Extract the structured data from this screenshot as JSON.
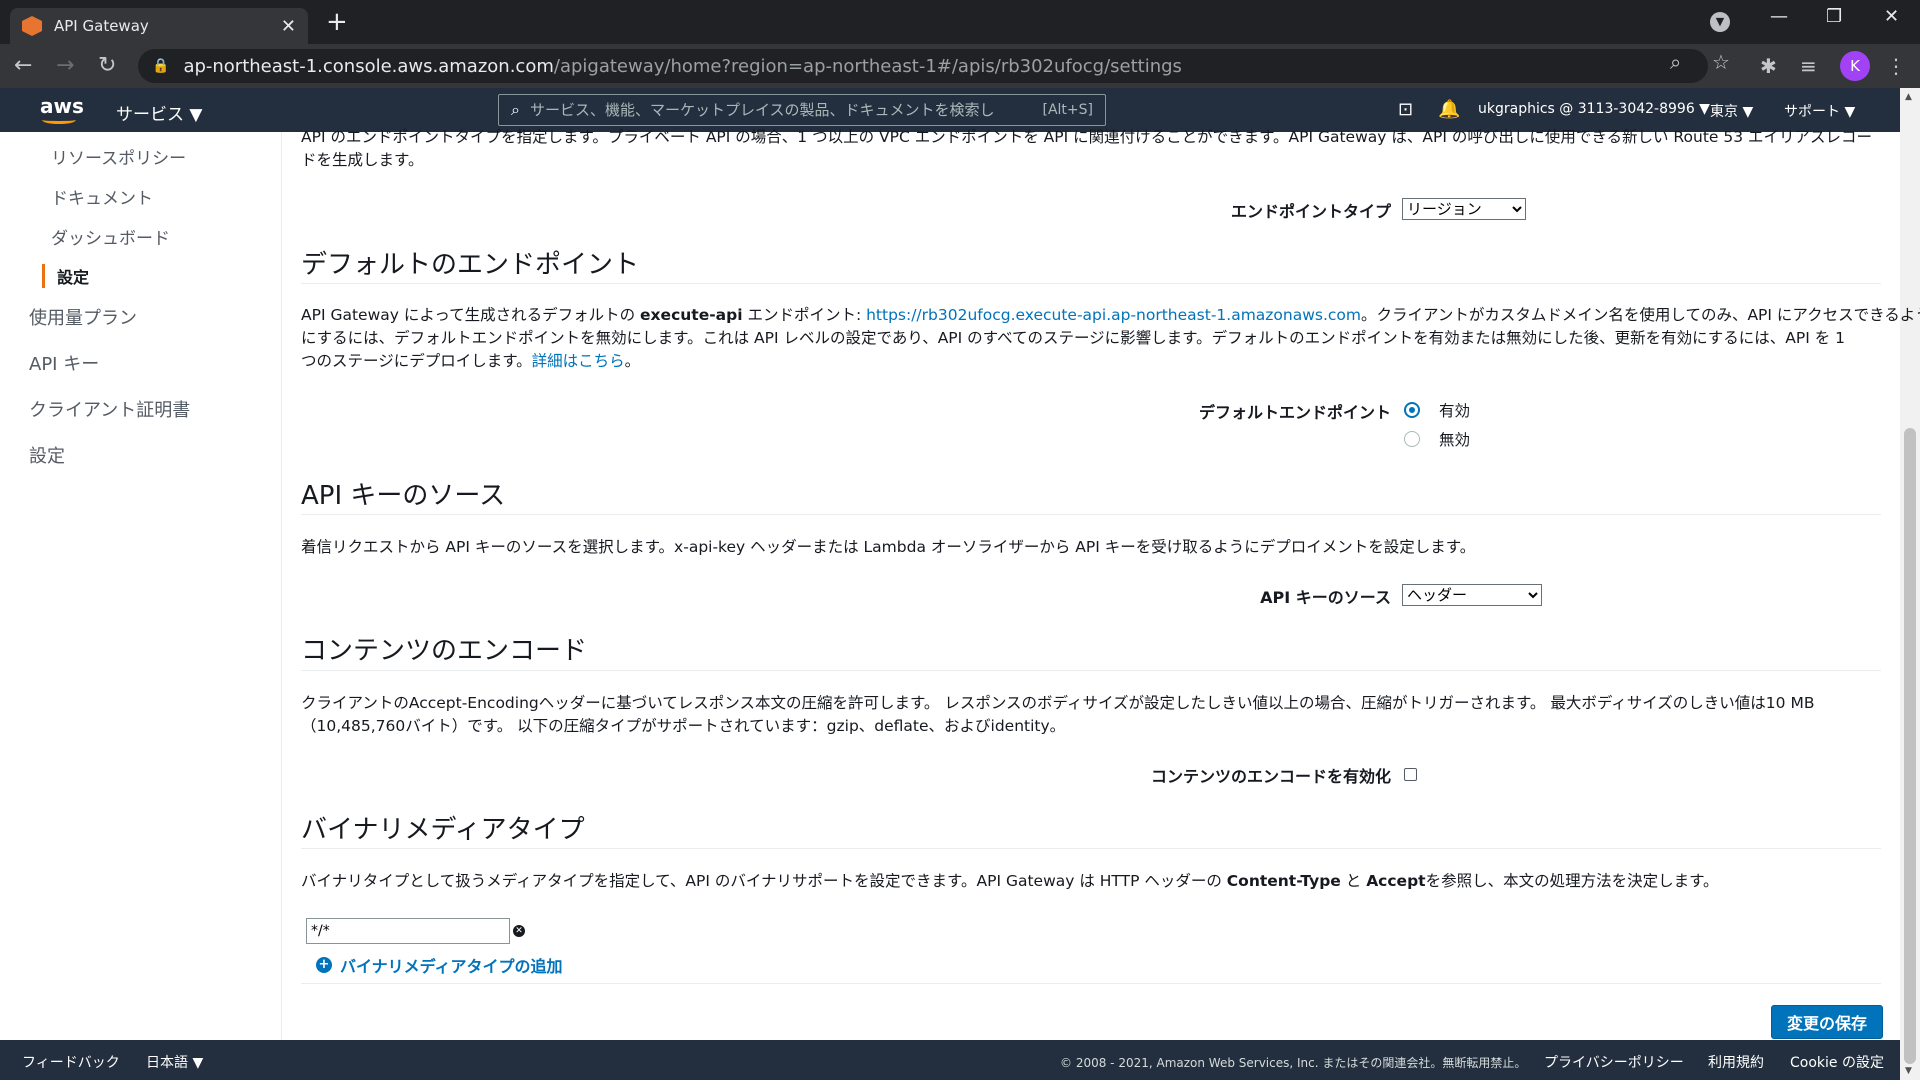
{
  "browser": {
    "tab_title": "API Gateway",
    "url_host": "ap-northeast-1.console.aws.amazon.com",
    "url_path": "/apigateway/home?region=ap-northeast-1#/apis/rb302ufocg/settings",
    "profile_initial": "K"
  },
  "aws_nav": {
    "logo": "aws",
    "services": "サービス ▼",
    "search_placeholder": "サービス、機能、マーケットプレイスの製品、ドキュメントを検索し",
    "search_shortcut": "[Alt+S]",
    "account": "ukgraphics @ 3113-3042-8996 ▼",
    "region": "東京 ▼",
    "support": "サポート ▼"
  },
  "sidebar": {
    "sub_items": [
      "リソースポリシー",
      "ドキュメント",
      "ダッシュボード"
    ],
    "active": "設定",
    "items": [
      "使用量プラン",
      "API キー",
      "クライアント証明書",
      "設定"
    ]
  },
  "endpoint": {
    "desc_line1": "API のエンドポイントタイプを指定します。プライベート API の場合、1 つ以上の VPC エンドポイントを API に関連付けることができます。API Gateway は、API の呼び出しに使用できる新しい Route 53 エイリアスレコー",
    "desc_line2": "ドを生成します。",
    "type_label": "エンドポイントタイプ",
    "type_value": "リージョン"
  },
  "default_endpoint": {
    "heading": "デフォルトのエンドポイント",
    "desc_pre": "API Gateway によって生成されるデフォルトの ",
    "desc_bold": "execute-api",
    "desc_mid": " エンドポイント: ",
    "desc_link": "https://rb302ufocg.execute-api.ap-northeast-1.amazonaws.com",
    "desc_post": "。クライアントがカスタムドメイン名を使用してのみ、API にアクセスできるよう",
    "desc_line2": "にするには、デフォルトエンドポイントを無効にします。これは API レベルの設定であり、API のすべてのステージに影響します。デフォルトのエンドポイントを有効または無効にした後、更新を有効にするには、API を 1",
    "desc_line3_pre": "つのステージにデプロイします。",
    "desc_line3_link": "詳細はこちら",
    "desc_line3_post": "。",
    "label": "デフォルトエンドポイント",
    "opt_enabled": "有効",
    "opt_disabled": "無効"
  },
  "api_key_source": {
    "heading": "API キーのソース",
    "desc": "着信リクエストから API キーのソースを選択します。x-api-key ヘッダーまたは Lambda オーソライザーから API キーを受け取るようにデプロイメントを設定します。",
    "label": "API キーのソース",
    "value": "ヘッダー"
  },
  "content_encoding": {
    "heading": "コンテンツのエンコード",
    "desc_line1": "クライアントのAccept-Encodingヘッダーに基づいてレスポンス本文の圧縮を許可します。 レスポンスのボディサイズが設定したしきい値以上の場合、圧縮がトリガーされます。 最大ボディサイズのしきい値は10 MB",
    "desc_line2": "（10,485,760バイト）です。 以下の圧縮タイプがサポートされています：gzip、deflate、およびidentity。",
    "label": "コンテンツのエンコードを有効化"
  },
  "binary_media": {
    "heading": "バイナリメディアタイプ",
    "desc_pre": "バイナリタイプとして扱うメディアタイプを指定して、API のバイナリサポートを設定できます。API Gateway は HTTP ヘッダーの ",
    "desc_b1": "Content-Type",
    "desc_mid": " と ",
    "desc_b2": "Accept",
    "desc_post": "を参照し、本文の処理方法を決定します。",
    "value": "*/*",
    "add_label": "バイナリメディアタイプの追加"
  },
  "save_label": "変更の保存",
  "footer": {
    "feedback": "フィードバック",
    "language": "日本語 ▼",
    "copyright": "© 2008 - 2021, Amazon Web Services, Inc. またはその関連会社。無断転用禁止。",
    "privacy": "プライバシーポリシー",
    "terms": "利用規約",
    "cookie": "Cookie の設定"
  }
}
